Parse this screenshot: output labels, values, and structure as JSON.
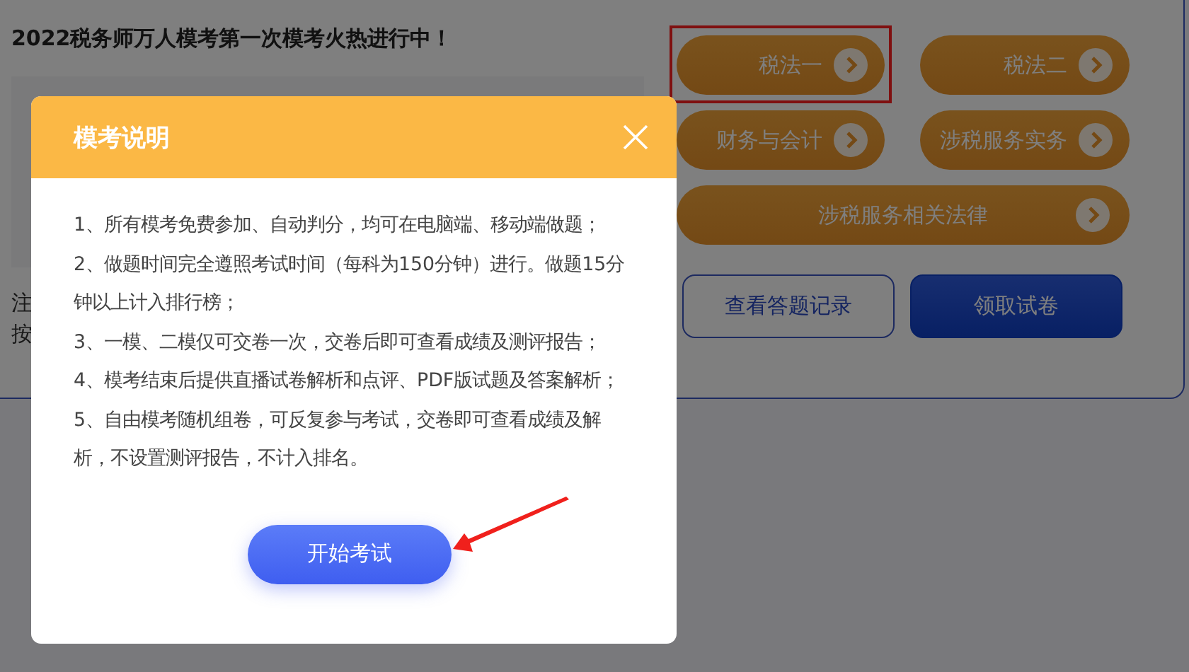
{
  "page": {
    "headline": "2022税务师万人模考第一次模考火热进行中！",
    "side_notes": [
      "注",
      "按"
    ],
    "subject_buttons": [
      {
        "label": "税法一",
        "highlighted": true,
        "wide": false
      },
      {
        "label": "税法二",
        "highlighted": false,
        "wide": false
      },
      {
        "label": "财务与会计",
        "highlighted": false,
        "wide": false
      },
      {
        "label": "涉税服务实务",
        "highlighted": false,
        "wide": false
      },
      {
        "label": "涉税服务相关法律",
        "highlighted": false,
        "wide": true
      }
    ],
    "action_buttons": [
      {
        "label": "查看答题记录",
        "kind": "outline"
      },
      {
        "label": "领取试卷",
        "kind": "filled"
      }
    ]
  },
  "modal": {
    "title": "模考说明",
    "items": [
      "1、所有模考免费参加、自动判分，均可在电脑端、移动端做题；",
      "2、做题时间完全遵照考试时间（每科为150分钟）进行。做题15分钟以上计入排行榜；",
      "3、一模、二模仅可交卷一次，交卷后即可查看成绩及测评报告；",
      "4、模考结束后提供直播试卷解析和点评、PDF版试题及答案解析；",
      "5、自由模考随机组卷，可反复参与考试，交卷即可查看成绩及解析，不设置测评报告，不计入排名。"
    ],
    "start_button": "开始考试"
  }
}
